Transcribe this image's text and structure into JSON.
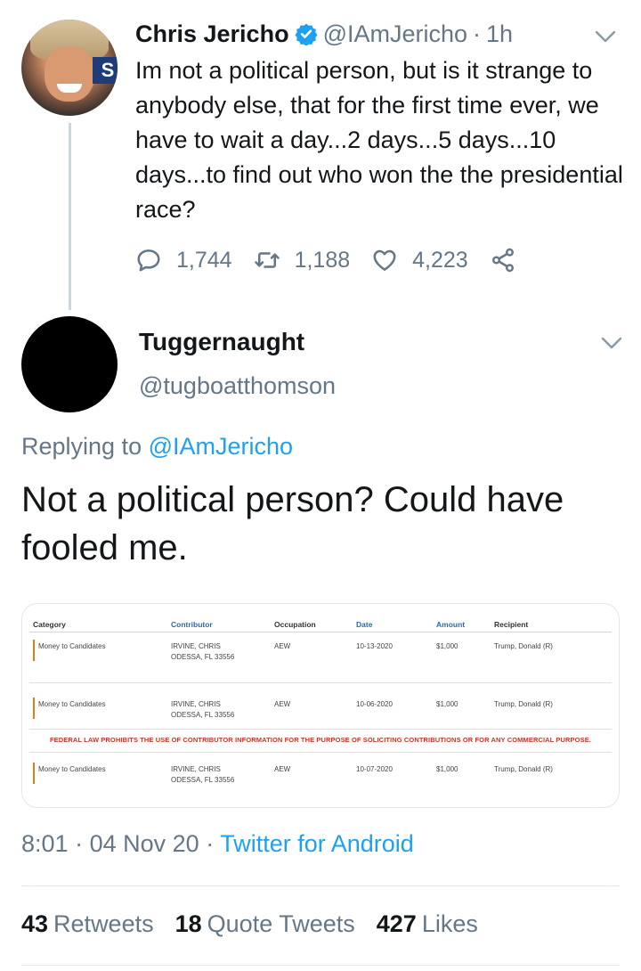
{
  "parent_tweet": {
    "name": "Chris Jericho",
    "handle": "@IAmJericho",
    "separator": "·",
    "time": "1h",
    "text": "Im not a political person, but is it strange to anybody else, that for the first time ever, we have to wait a day...2 days...5 days...10 days...to find out who won the the presidential race?",
    "replies": "1,744",
    "retweets": "1,188",
    "likes": "4,223",
    "avatar_sign": "S"
  },
  "reply_tweet": {
    "name": "Tuggernaught",
    "handle": "@tugboatthomson",
    "replying_prefix": "Replying to",
    "replying_to": "@IAmJericho",
    "text": "Not a political person? Could have fooled me."
  },
  "image_table": {
    "headers": [
      "Category",
      "Contributor",
      "Occupation",
      "Date",
      "Amount",
      "Recipient"
    ],
    "rows": [
      {
        "category": "Money to Candidates",
        "contributor": "IRVINE, CHRIS",
        "address": "ODESSA, FL 33556",
        "occupation": "AEW",
        "date": "10-13-2020",
        "amount": "$1,000",
        "recipient": "Trump, Donald (R)"
      },
      {
        "category": "Money to Candidates",
        "contributor": "IRVINE, CHRIS",
        "address": "ODESSA, FL 33556",
        "occupation": "AEW",
        "date": "10-06-2020",
        "amount": "$1,000",
        "recipient": "Trump, Donald (R)"
      },
      {
        "category": "Money to Candidates",
        "contributor": "IRVINE, CHRIS",
        "address": "ODESSA, FL 33556",
        "occupation": "AEW",
        "date": "10-07-2020",
        "amount": "$1,000",
        "recipient": "Trump, Donald (R)"
      }
    ],
    "warning": "FEDERAL LAW PROHIBITS THE USE OF CONTRIBUTOR INFORMATION FOR THE PURPOSE OF SOLICITING CONTRIBUTIONS OR FOR ANY COMMERCIAL PURPOSE."
  },
  "meta": {
    "time": "8:01",
    "sep1": "·",
    "date": "04 Nov 20",
    "sep2": "·",
    "source": "Twitter for Android"
  },
  "stats": {
    "retweets_count": "43",
    "retweets_label": "Retweets",
    "quotes_count": "18",
    "quotes_label": "Quote Tweets",
    "likes_count": "427",
    "likes_label": "Likes"
  },
  "colors": {
    "accent": "#1da1f2",
    "muted": "#657786",
    "text": "#14171a"
  },
  "icons": [
    "verified-badge-icon",
    "chevron-down-icon",
    "reply-icon",
    "retweet-icon",
    "like-icon",
    "share-icon"
  ]
}
